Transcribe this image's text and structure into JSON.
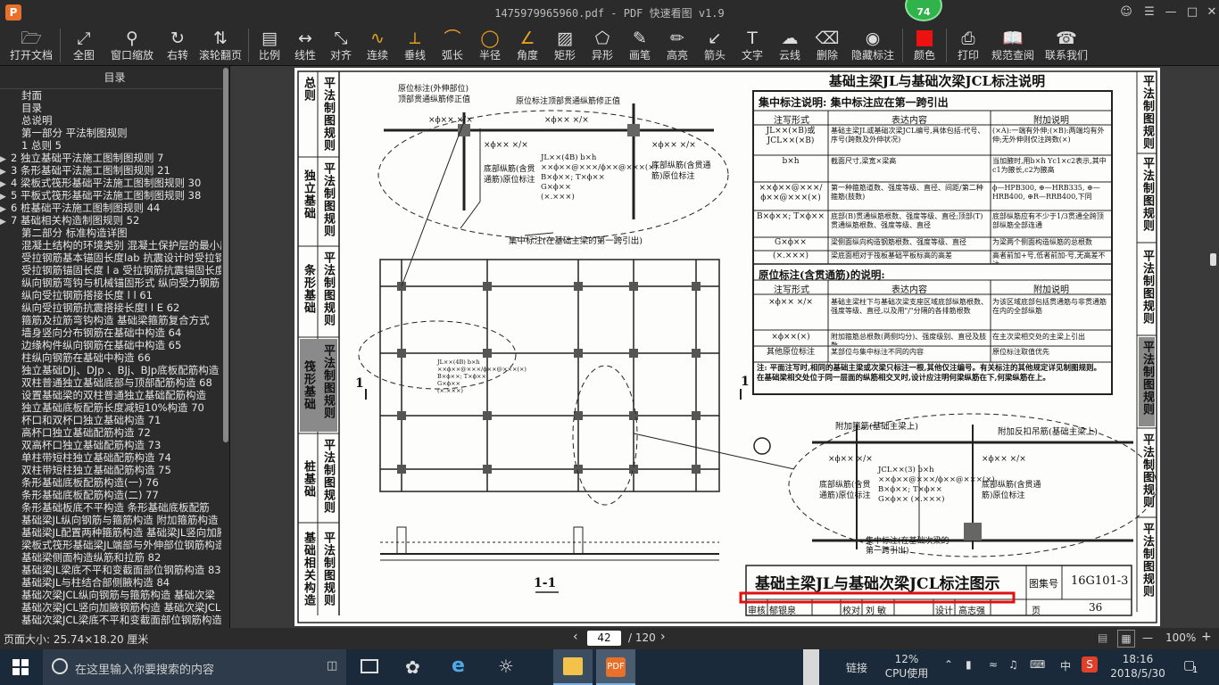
{
  "window": {
    "title": "1475979965960.pdf - PDF 快速看图 v1.9",
    "badge": "74",
    "controls": [
      "minimize",
      "maximize",
      "close"
    ]
  },
  "toolbar": {
    "items": [
      {
        "label": "打开文档",
        "icon": "folder-icon"
      },
      {
        "label": "全图",
        "icon": "fit-page-icon"
      },
      {
        "label": "窗口缩放",
        "icon": "zoom-icon"
      },
      {
        "label": "右转",
        "icon": "rotate-right-icon"
      },
      {
        "label": "滚轮翻页",
        "icon": "mouse-wheel-icon"
      },
      {
        "label": "比例",
        "icon": "ruler-icon"
      },
      {
        "label": "线性",
        "icon": "linear-dimension-icon"
      },
      {
        "label": "对齐",
        "icon": "aligned-dimension-icon"
      },
      {
        "label": "连续",
        "icon": "continuous-dimension-icon"
      },
      {
        "label": "垂线",
        "icon": "perpendicular-icon"
      },
      {
        "label": "弧长",
        "icon": "arc-length-icon"
      },
      {
        "label": "半径",
        "icon": "radius-icon"
      },
      {
        "label": "角度",
        "icon": "angle-icon"
      },
      {
        "label": "矩形",
        "icon": "rectangle-area-icon"
      },
      {
        "label": "异形",
        "icon": "polygon-area-icon"
      },
      {
        "label": "画笔",
        "icon": "pen-icon"
      },
      {
        "label": "高亮",
        "icon": "highlighter-icon"
      },
      {
        "label": "箭头",
        "icon": "arrow-icon"
      },
      {
        "label": "文字",
        "icon": "text-icon"
      },
      {
        "label": "云线",
        "icon": "cloud-line-icon"
      },
      {
        "label": "删除",
        "icon": "eraser-icon"
      },
      {
        "label": "隐藏标注",
        "icon": "eye-hide-icon"
      },
      {
        "label": "颜色",
        "icon": "color-swatch-icon"
      },
      {
        "label": "打印",
        "icon": "printer-icon"
      },
      {
        "label": "规范查阅",
        "icon": "book-icon"
      },
      {
        "label": "联系我们",
        "icon": "contact-icon"
      }
    ],
    "color_swatch": "#ee1111"
  },
  "sidebar": {
    "title": "目录",
    "items": [
      {
        "text": "封面",
        "arrow": false
      },
      {
        "text": "目录",
        "arrow": false
      },
      {
        "text": "总说明",
        "arrow": false
      },
      {
        "text": "第一部分  平法制图规则",
        "arrow": false
      },
      {
        "text": "1 总则 5",
        "arrow": false
      },
      {
        "text": "2 独立基础平法施工图制图规则 7",
        "arrow": true
      },
      {
        "text": "3 条形基础平法施工图制图规则 21",
        "arrow": true
      },
      {
        "text": "4 梁板式筏形基础平法施工图制图规则 30",
        "arrow": true
      },
      {
        "text": "5 平板式筏形基础平法施工图制图规则 38",
        "arrow": true
      },
      {
        "text": "6 桩基础平法施工图制图规则 44",
        "arrow": true
      },
      {
        "text": "7 基础相关构造制图规则 52",
        "arrow": true
      },
      {
        "text": "第二部分  标准构造详图",
        "arrow": false
      },
      {
        "text": "混凝土结构的环境类别 混凝土保护层的最小厚度",
        "arrow": false
      },
      {
        "text": "受拉钢筋基本锚固长度lab 抗震设计时受拉钢筋",
        "arrow": false
      },
      {
        "text": "受拉钢筋锚固长度 l a 受拉钢筋抗震锚固长度",
        "arrow": false
      },
      {
        "text": "纵向钢筋弯钩与机械锚固形式 纵向受力钢筋",
        "arrow": false
      },
      {
        "text": "纵向受拉钢筋搭接长度 l l  61",
        "arrow": false
      },
      {
        "text": "纵向受拉钢筋抗震搭接长度l l E 62",
        "arrow": false
      },
      {
        "text": "箍筋及拉筋弯钩构造 基础梁箍筋复合方式",
        "arrow": false
      },
      {
        "text": "墙身竖向分布钢筋在基础中构造 64",
        "arrow": false
      },
      {
        "text": "边缘构件纵向钢筋在基础中构造 65",
        "arrow": false
      },
      {
        "text": "柱纵向钢筋在基础中构造 66",
        "arrow": false
      },
      {
        "text": "独立基础DJj、DJp 、BJj、BJp底板配筋构造",
        "arrow": false
      },
      {
        "text": "双柱普通独立基础底部与顶部配筋构造 68",
        "arrow": false
      },
      {
        "text": "设置基础梁的双柱普通独立基础配筋构造",
        "arrow": false
      },
      {
        "text": "独立基础底板配筋长度减短10%构造 70",
        "arrow": false
      },
      {
        "text": "杯口和双杯口独立基础构造 71",
        "arrow": false
      },
      {
        "text": "高杯口独立基础配筋构造 72",
        "arrow": false
      },
      {
        "text": "双高杯口独立基础配筋构造 73",
        "arrow": false
      },
      {
        "text": "单柱带短柱独立基础配筋构造 74",
        "arrow": false
      },
      {
        "text": "双柱带短柱独立基础配筋构造 75",
        "arrow": false
      },
      {
        "text": "条形基础底板配筋构造(一) 76",
        "arrow": false
      },
      {
        "text": "条形基础底板配筋构造(二) 77",
        "arrow": false
      },
      {
        "text": "条形基础板底不平构造 条形基础底板配筋",
        "arrow": false
      },
      {
        "text": "基础梁JL纵向钢筋与箍筋构造 附加箍筋构造",
        "arrow": false
      },
      {
        "text": "基础梁JL配置两种箍筋构造 基础梁JL竖向加腋",
        "arrow": false
      },
      {
        "text": "梁板式筏形基础梁JL端部与外伸部位钢筋构造",
        "arrow": false
      },
      {
        "text": "基础梁侧面构造纵筋和拉筋 82",
        "arrow": false
      },
      {
        "text": "基础梁JL梁底不平和变截面部位钢筋构造 83",
        "arrow": false
      },
      {
        "text": "基础梁JL与柱结合部侧腋构造 84",
        "arrow": false
      },
      {
        "text": "基础次梁JCL纵向钢筋与箍筋构造 基础次梁",
        "arrow": false
      },
      {
        "text": "基础次梁JCL竖向加腋钢筋构造 基础次梁JCL",
        "arrow": false
      },
      {
        "text": "基础次梁JCL梁底不平和变截面部位钢筋构造",
        "arrow": false
      }
    ]
  },
  "document": {
    "left_tabs": [
      "总则",
      "平法制图规则",
      "独立基础",
      "平法制图规则",
      "条形基础",
      "平法制图规则",
      "筏形基础",
      "平法制图规则",
      "桩基础",
      "平法制图规则",
      "基础相关构造",
      "平法制图规则"
    ],
    "right_tabs": [
      "平法制图规则",
      "平法制图规则",
      "平法制图规则",
      "平法制图规则",
      "平法制图规则",
      "平法制图规则"
    ],
    "heading": "基础主梁JL与基础次梁JCL标注说明",
    "concentrated_title": "集中标注说明: 集中标注应在第一跨引出",
    "table_headers": [
      "注写形式",
      "表达内容",
      "附加说明"
    ],
    "concentrated_rows": [
      {
        "form": "JL××(×B)或\nJCL××(×B)",
        "content": "基础主梁JL或基础次梁JCL编号,具体包括:代号、序号(跨数及外伸状况)",
        "note": "(×A):一端有外伸;(×B):两端均有外伸;无外伸则仅注跨数(×)"
      },
      {
        "form": "b×h",
        "content": "截面尺寸,梁宽×梁高",
        "note": "当加腋时,用b×h Yc1×c2表示,其中c1为腋长,c2为腋高"
      },
      {
        "form": "××ϕ××@×××/\nϕ××@×××(×)",
        "content": "第一种箍筋道数、强度等级、直径、间距/第二种箍筋(肢数)",
        "note": "ϕ—HPB300, ⊕—HRB335, ⊕—HRB400, ⊕R—RRB400,下同"
      },
      {
        "form": "B×ϕ××; T×ϕ××",
        "content": "底部(B)贯通纵筋根数、强度等级、直径;顶部(T)贯通纵筋根数、强度等级、直径",
        "note": "底部纵筋应有不少于1/3贯通全跨顶部纵筋全部连通"
      },
      {
        "form": "G×ϕ××",
        "content": "梁侧面纵向构造钢筋根数、强度等级、直径",
        "note": "为梁两个侧面构造纵筋的总根数"
      },
      {
        "form": "(×.×××)",
        "content": "梁底面相对于筏板基础平板标高的高差",
        "note": "高者前加+号,低者前加-号,无高差不注"
      }
    ],
    "original_title": "原位标注(含贯通筋)的说明:",
    "original_rows": [
      {
        "form": "×ϕ×× ×/×",
        "content": "基础主梁柱下与基础次梁支座区域底部纵筋根数、强度等级、直径,以及用\"/\"分隔的各排筋根数",
        "note": "为该区域底部包括贯通筋与非贯通筋在内的全部纵筋"
      },
      {
        "form": "×ϕ××(×)",
        "content": "附加箍筋总根数(两侧均分)、强度级别、直径及肢数",
        "note": "在主次梁相交处的主梁上引出"
      },
      {
        "form": "其他原位标注",
        "content": "某部位与集中标注不同的内容",
        "note": "原位标注取值优先"
      }
    ],
    "table_note": "注: 平面注写时,相同的基础主梁或次梁只标注一根,其他仅注编号。有关标注的其他规定详见制图规则。在基础梁相交处位于同一层面的纵筋相交叉时,设计应注明何梁纵筋在下,何梁纵筋在上。",
    "labels": {
      "outer_label_1": "原位标注(外伸部位)",
      "outer_label_2": "顶部贯通纵筋修正值",
      "top_label": "原位标注顶部贯通纵筋修正值",
      "mark_a": "×ϕ×× ×/×",
      "mark_b": "×ϕ×× ×/×",
      "mark_c": "×ϕ×× ×/×",
      "main_annot": "JL××(4B) b×h\n××ϕ××@×××/ϕ××@×××(×)\nB×ϕ××; T×ϕ××\nG×ϕ××\n(×.×××)",
      "left_bottom": "底部纵筋(含贯通筋)原位标注",
      "right_bottom": "底部纵筋(含贯通筋)原位标注",
      "concentrated": "集中标注(在基础主梁的第一跨引出)",
      "section_mark": "1",
      "section_label": "1-1",
      "extra_stirrup": "附加箍筋(基础主梁上)",
      "extra_hanger": "附加反扣吊筋(基础主梁上)",
      "jcl_annot": "JCL××(3) b×h\n××ϕ××@×××/ϕ××@×××(×)\nB×ϕ××; T×ϕ××\nG×ϕ×× (×.×××)",
      "bottom_left_r": "底部纵筋(含贯通筋)原位标注",
      "bottom_right_r": "底部纵筋(含贯通筋)原位标注",
      "concentrated_r": "集中标注(在基础次梁的第一跨引出)"
    },
    "title_block": {
      "title": "基础主梁JL与基础次梁JCL标注图示",
      "atlas_label": "图集号",
      "atlas_no": "16G101-3",
      "row": [
        "审核",
        "郁银泉",
        "校对",
        "刘 敏",
        "设计",
        "高志强",
        "页"
      ],
      "page_no": "36"
    }
  },
  "statusbar": {
    "page_size": "页面大小: 25.74×18.20 厘米",
    "current_page": "42",
    "total_pages": "/ 120",
    "zoom": "100%"
  },
  "taskbar": {
    "search_placeholder": "在这里输入你要搜索的内容",
    "network": "链接",
    "cpu_percent": "12%",
    "cpu_label": "CPU使用",
    "ime": "中",
    "time": "18:16",
    "date": "2018/5/30",
    "notifications": "1"
  }
}
